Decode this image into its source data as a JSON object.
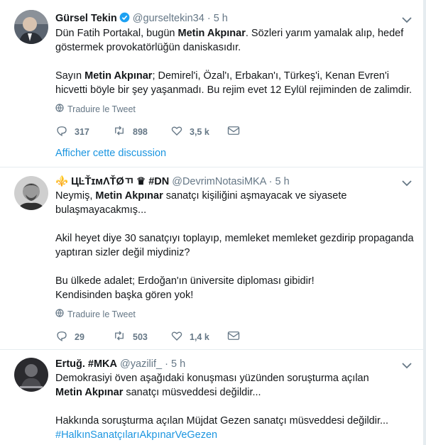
{
  "tweets": [
    {
      "name": "Gürsel Tekin",
      "handle": "@gurseltekin34",
      "dot": "·",
      "time": "5 h",
      "verified": true,
      "p1_a": "Dün Fatih Portakal, bugün ",
      "p1_kw": "Metin Akpınar",
      "p1_b": ". Sözleri yarım yamalak alıp, hedef göstermek provokatörlüğün daniskasıdır.",
      "p2_a": "Sayın ",
      "p2_kw": "Metin Akpınar",
      "p2_b": "; Demirel'i, Özal'ı, Erbakan'ı, Türkeş'i, Kenan Evren'i hicvetti böyle bir şey yaşanmadı. Bu rejim evet 12 Eylül rejiminden de zalimdir.",
      "translate": "Traduire le Tweet",
      "replies": "317",
      "retweets": "898",
      "likes": "3,5 k",
      "show_thread": "Afficher cette discussion"
    },
    {
      "name": "⚜️ ЦĿŤɪᴍΛŤØㄲ ♛ #DN",
      "handle": "@DevrimNotasiMKA",
      "dot": "·",
      "time": "5 h",
      "p1_a": "Neymiş, ",
      "p1_kw": "Metin Akpınar",
      "p1_b": " sanatçı kişiliğini aşmayacak ve siyasete bulaşmayacakmış...",
      "p2": "Akil heyet diye 30 sanatçıyı toplayıp, memleket memleket gezdirip propaganda yaptıran sizler değil miydiniz?",
      "p3_l1": "Bu ülkede adalet; Erdoğan'ın üniversite diploması gibidir!",
      "p3_l2": "Kendisinden başka gören yok!",
      "translate": "Traduire le Tweet",
      "replies": "29",
      "retweets": "503",
      "likes": "1,4 k"
    },
    {
      "name": "Ertuğ. #MKA",
      "handle": "@yazilif_",
      "dot": "·",
      "time": "5 h",
      "p1": "Demokrasiyi öven aşağıdaki konuşması yüzünden soruşturma açılan",
      "p1_kw": "Metin Akpınar",
      "p1_b": " sanatçı müsveddesi değildir...",
      "p2": "Hakkında soruşturma açılan Müjdat Gezen sanatçı müsveddesi değildir...",
      "hashtag": "#HalkınSanatçılarıAkpınarVeGezen"
    }
  ],
  "colors": {
    "accent": "#1b95e0",
    "muted": "#657786",
    "text": "#14171a",
    "border": "#e6ecf0"
  },
  "icons": [
    "reply-icon",
    "retweet-icon",
    "like-icon",
    "message-icon",
    "globe-icon",
    "chevron-down-icon",
    "verified-badge-icon"
  ]
}
